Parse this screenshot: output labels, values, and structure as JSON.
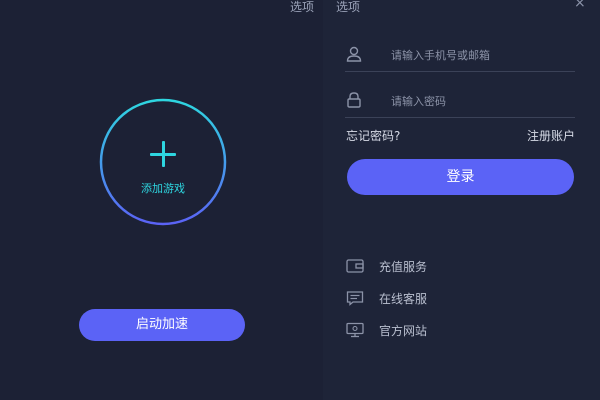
{
  "header": {
    "left_options_label": "选项",
    "right_options_label": "选项",
    "close_label": "×"
  },
  "left": {
    "add_game_label": "添加游戏",
    "start_button_label": "启动加速",
    "ring_gradient": [
      "#2ed6e0",
      "#5b63f6"
    ]
  },
  "login": {
    "account_placeholder": "请输入手机号或邮箱",
    "password_placeholder": "请输入密码",
    "forgot_label": "忘记密码?",
    "register_label": "注册账户",
    "login_button_label": "登录"
  },
  "services": [
    {
      "label": "充值服务",
      "icon": "wallet-icon"
    },
    {
      "label": "在线客服",
      "icon": "chat-icon"
    },
    {
      "label": "官方网站",
      "icon": "monitor-icon"
    }
  ],
  "colors": {
    "accent": "#5b63f6",
    "cyan": "#2ed6e0",
    "panel_left": "#1c2135",
    "panel_right": "#1e2438"
  }
}
